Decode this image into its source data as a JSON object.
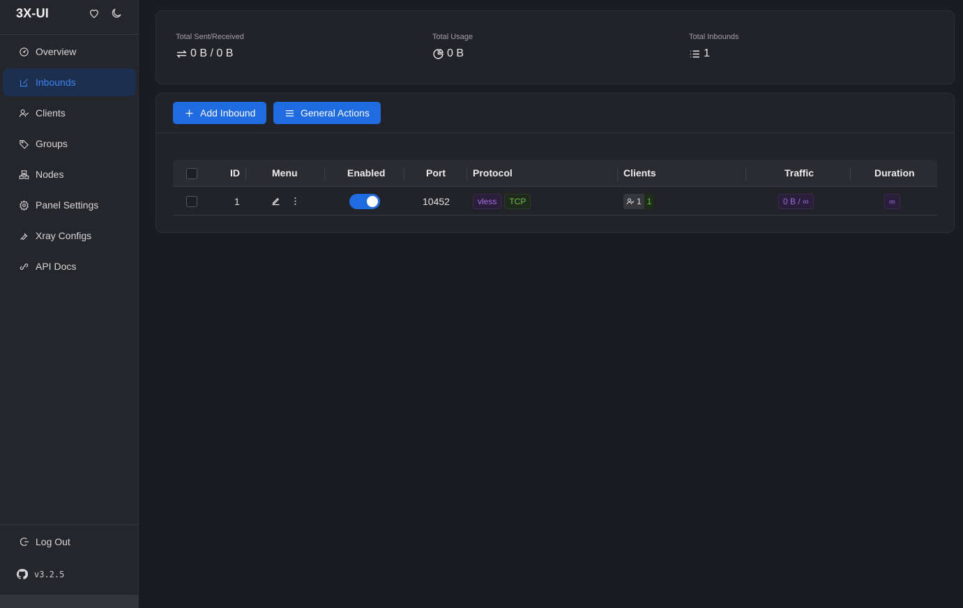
{
  "app": {
    "brand": "3X-UI",
    "version": "v3.2.5",
    "accent_color": "#1f6be0"
  },
  "sidebar": {
    "items": [
      {
        "label": "Overview",
        "icon": "dashboard-icon",
        "active": false
      },
      {
        "label": "Inbounds",
        "icon": "edit-square-icon",
        "active": true
      },
      {
        "label": "Clients",
        "icon": "users-icon",
        "active": false
      },
      {
        "label": "Groups",
        "icon": "tag-icon",
        "active": false
      },
      {
        "label": "Nodes",
        "icon": "cluster-icon",
        "active": false
      },
      {
        "label": "Panel Settings",
        "icon": "gear-icon",
        "active": false
      },
      {
        "label": "Xray Configs",
        "icon": "tool-icon",
        "active": false
      },
      {
        "label": "API Docs",
        "icon": "api-icon",
        "active": false
      }
    ],
    "logout_label": "Log Out"
  },
  "stats": {
    "sent_received": {
      "label": "Total Sent/Received",
      "value": "0 B / 0 B"
    },
    "usage": {
      "label": "Total Usage",
      "value": "0 B"
    },
    "inbounds": {
      "label": "Total Inbounds",
      "value": "1"
    }
  },
  "actions": {
    "add_inbound": "Add Inbound",
    "general_actions": "General Actions"
  },
  "table": {
    "columns": [
      "ID",
      "Menu",
      "Enabled",
      "Port",
      "Protocol",
      "Clients",
      "Traffic",
      "Duration"
    ],
    "rows": [
      {
        "id": "1",
        "enabled": true,
        "port": "10452",
        "protocol": "vless",
        "transport": "TCP",
        "clients_total": "1",
        "clients_active": "1",
        "traffic": "0 B / ∞",
        "duration": "∞"
      }
    ]
  }
}
